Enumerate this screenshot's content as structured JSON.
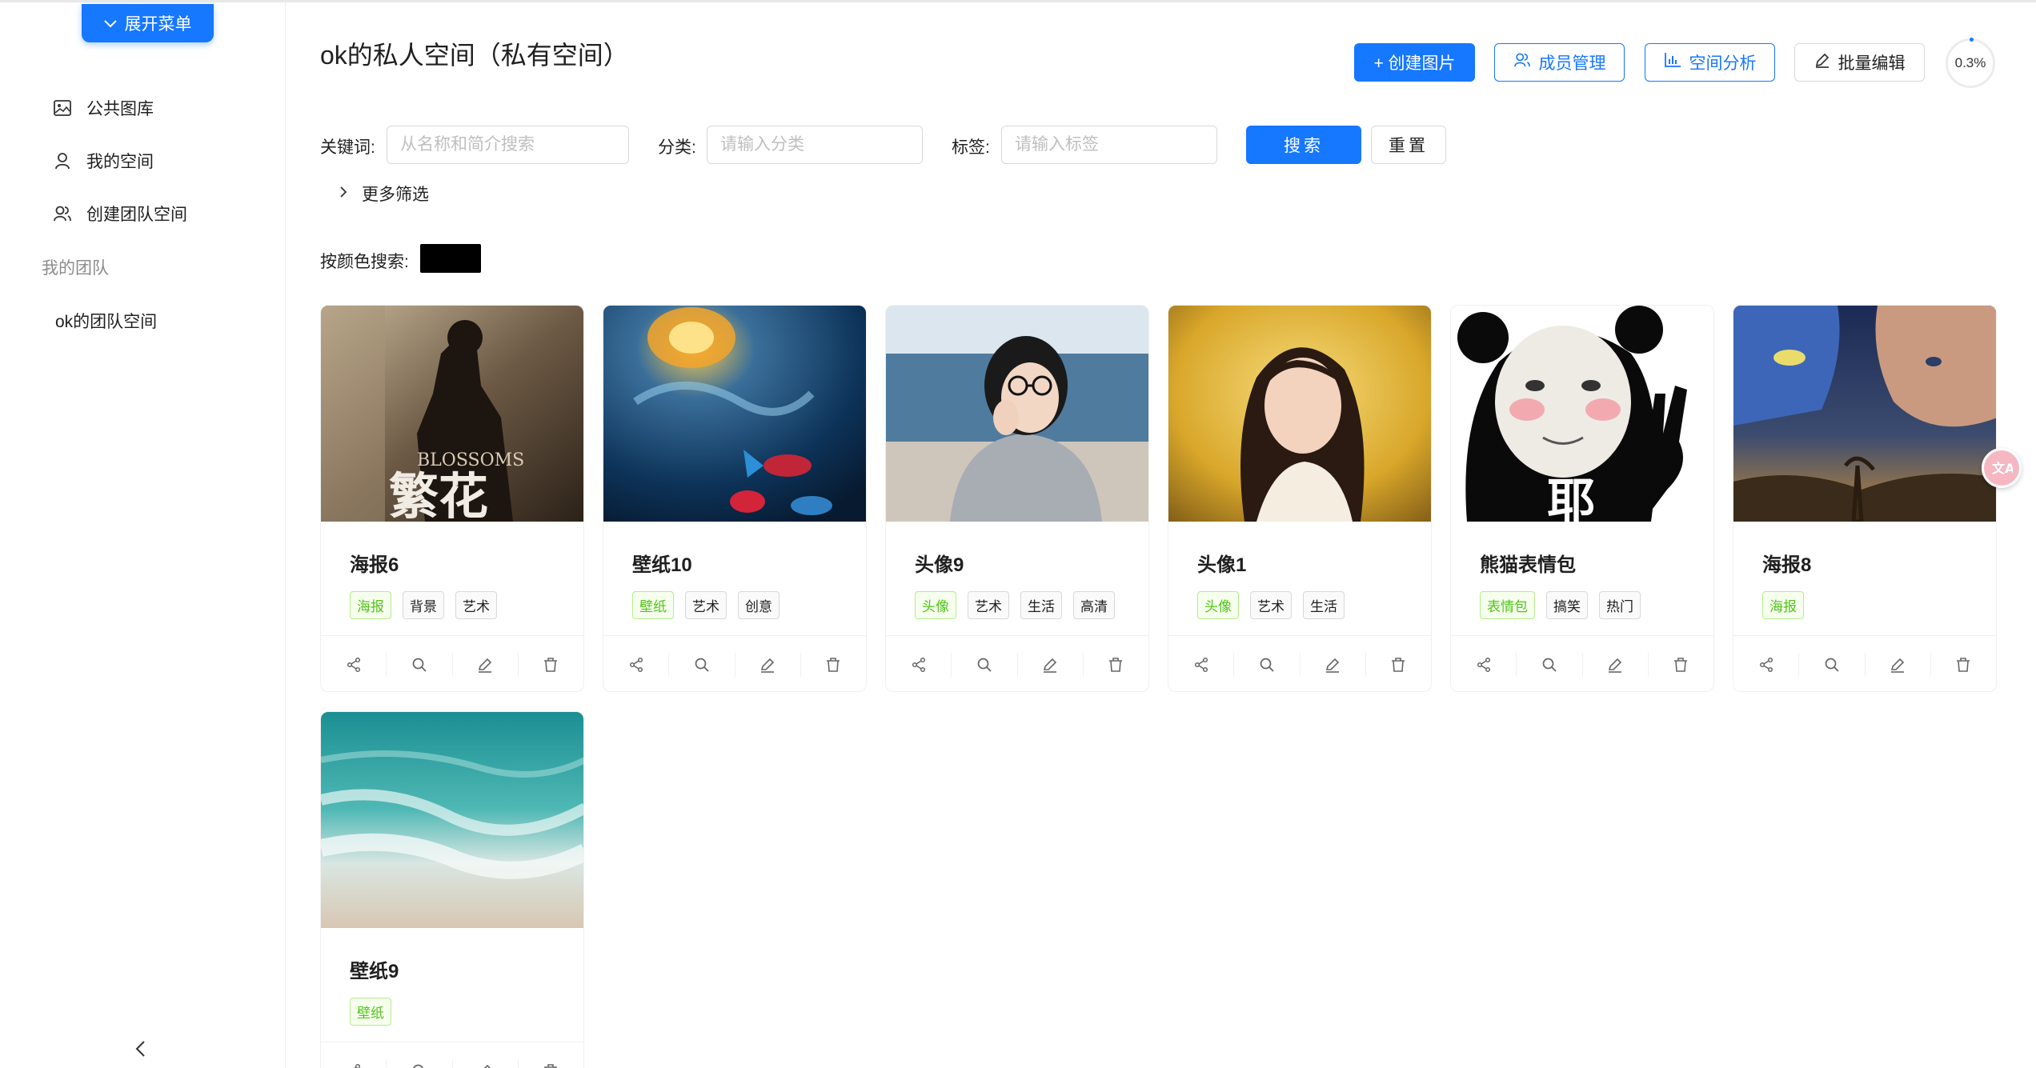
{
  "sidebar": {
    "expand_label": "展开菜单",
    "items": [
      {
        "label": "公共图库",
        "icon": "picture-icon"
      },
      {
        "label": "我的空间",
        "icon": "user-icon"
      },
      {
        "label": "创建团队空间",
        "icon": "team-icon"
      }
    ],
    "group_label": "我的团队",
    "team_space": "ok的团队空间"
  },
  "header": {
    "title": "ok的私人空间（私有空间）",
    "create_btn": "+ 创建图片",
    "member_btn": "成员管理",
    "analysis_btn": "空间分析",
    "batch_btn": "批量编辑",
    "usage": "0.3%",
    "usage_fraction": 0.003
  },
  "filters": {
    "keyword_label": "关键词:",
    "keyword_placeholder": "从名称和简介搜索",
    "category_label": "分类:",
    "category_placeholder": "请输入分类",
    "tag_label": "标签:",
    "tag_placeholder": "请输入标签",
    "search_btn": "搜索",
    "reset_btn": "重置",
    "more_filter": "更多筛选",
    "color_label": "按颜色搜索:",
    "color_value": "#000000"
  },
  "cards": [
    {
      "title": "海报6",
      "tags": [
        "海报",
        "背景",
        "艺术"
      ]
    },
    {
      "title": "壁纸10",
      "tags": [
        "壁纸",
        "艺术",
        "创意"
      ]
    },
    {
      "title": "头像9",
      "tags": [
        "头像",
        "艺术",
        "生活",
        "高清"
      ]
    },
    {
      "title": "头像1",
      "tags": [
        "头像",
        "艺术",
        "生活"
      ]
    },
    {
      "title": "熊猫表情包",
      "tags": [
        "表情包",
        "搞笑",
        "热门"
      ]
    },
    {
      "title": "海报8",
      "tags": [
        "海报"
      ]
    },
    {
      "title": "壁纸9",
      "tags": [
        "壁纸"
      ]
    }
  ],
  "card_image_text": {
    "poster6": "BLOSSOMS",
    "poster6_calligraphy": "繁花",
    "panda_char": "耶"
  },
  "colors": {
    "primary": "#1677ff",
    "tag_green": "#52c41a"
  }
}
